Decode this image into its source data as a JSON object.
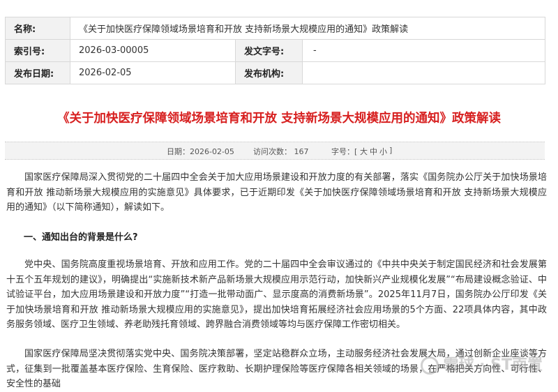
{
  "meta": {
    "name_label": "名称:",
    "name_value": "《关于加快医疗保障领域场景培育和开放 支持新场景大规模应用的通知》政策解读",
    "index_label": "索引号:",
    "index_value": "2026-03-00005",
    "docno_label": "发文字号:",
    "docno_value": "-",
    "date_label": "发布日期:",
    "date_value": "2026-02-05",
    "org_label": "发布机构:",
    "org_value": ""
  },
  "article": {
    "title": "《关于加快医疗保障领域场景培育和开放 支持新场景大规模应用的通知》政策解读",
    "info": {
      "date": "日期：2026-02-05",
      "visits": "访问次数：  167",
      "font_size_label": "字号：[",
      "size_large": "大",
      "size_medium": "中",
      "size_small": "小",
      "bracket_close": "]"
    },
    "paragraph1": "国家医疗保障局深入贯彻党的二十届四中全会关于加大应用场景建设和开放力度的有关部署，落实《国务院办公厅关于加快场景培育和开放 推动新场景大规模应用的实施意见》具体要求，已于近期印发《关于加快医疗保障领域场景培育和开放 支持新场景大规模应用的通知》（以下简称通知），解读如下。",
    "heading1": "一、通知出台的背景是什么?",
    "paragraph2": "党中央、国务院高度重视场景培育、开放和应用工作。党的二十届四中全会审议通过的《中共中央关于制定国民经济和社会发展第十五个五年规划的建议》，明确提出“实施新技术新产品新场景大规模应用示范行动，加快新兴产业规模化发展”“布局建设概念验证、中试验证平台，加大应用场景建设和开放力度”“打造一批带动面广、显示度高的消费新场景”。2025年11月7日，国务院办公厅印发《关于加快场景培育和开放 推动新场景大规模应用的实施意见》，提出加快培育拓展经济社会应用场景的5个方面、22项具体内容，其中政务服务领域、医疗卫生领域、养老助残托育领域、跨界融合消费领域等均与医疗保障工作密切相关。",
    "paragraph3": "国家医疗保障局坚决贯彻落实党中央、国务院决策部署，坚定站稳群众立场，主动服务经济社会发展大局，通过创新企业座谈等方式，征集到一批覆盖基本医疗保险、生育保险、医疗救助、长期护理保险等医疗保障各相关领域的场景，在严格把关方向性、可行性、安全性的基础"
  },
  "watermark": "雪球 · ST南置"
}
